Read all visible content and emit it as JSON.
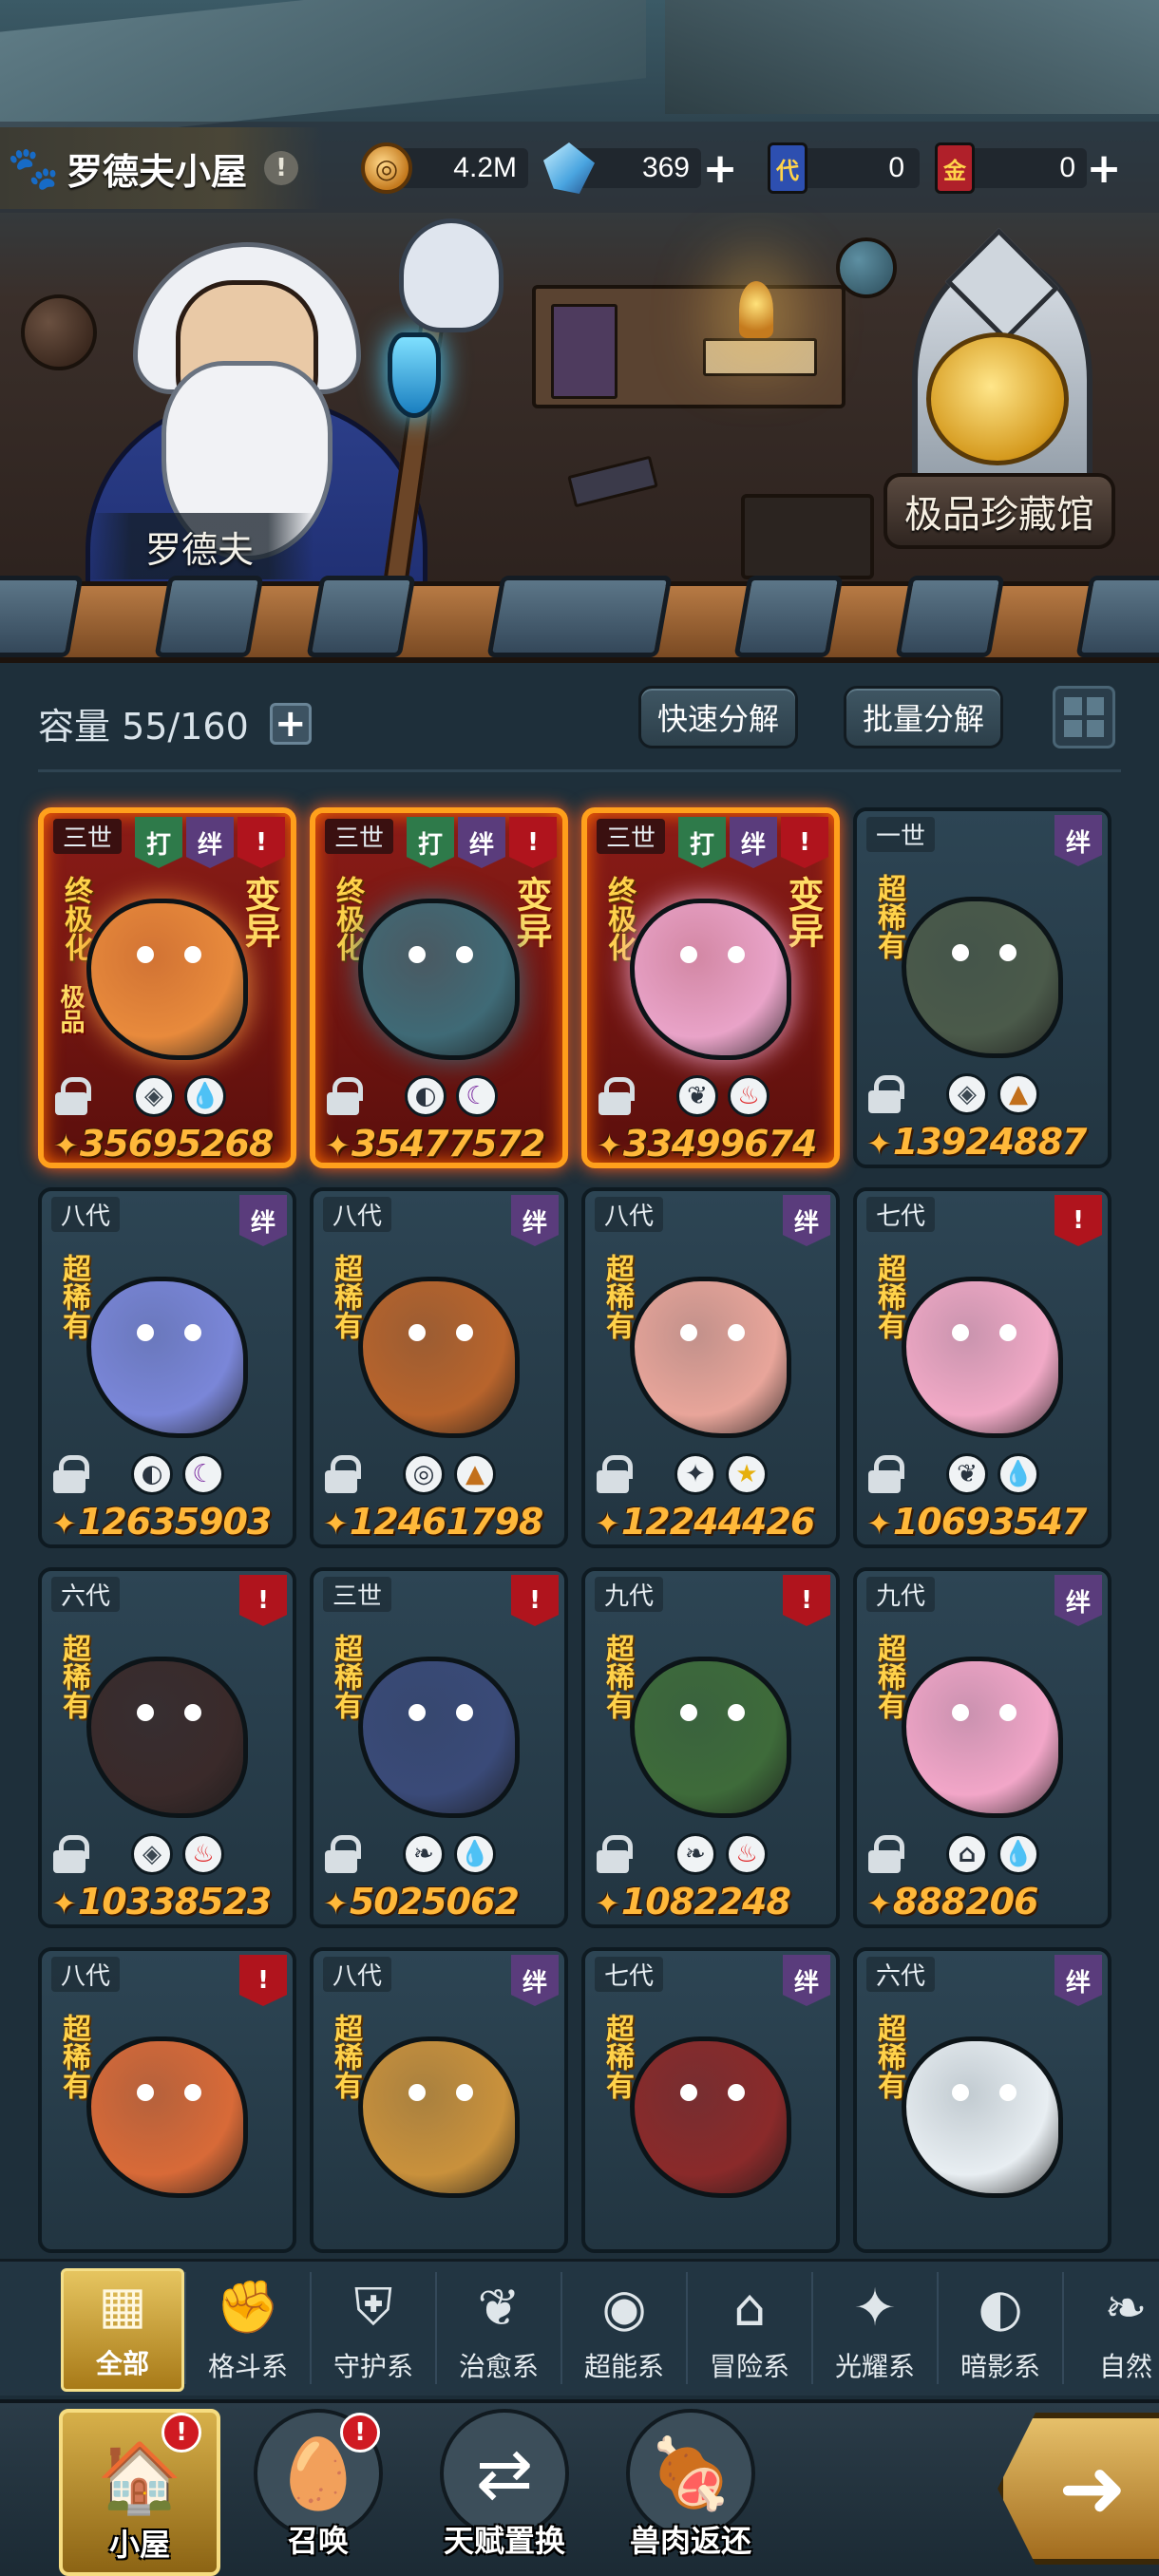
{
  "header": {
    "title": "罗德夫小屋",
    "title_alert": "!",
    "npc_name": "罗德夫",
    "museum_label": "极品珍藏馆"
  },
  "resources": {
    "coins": "4.2M",
    "crystals": "369",
    "blue_card": "0",
    "blue_card_icon_text": "代",
    "red_card": "0",
    "red_card_icon_text": "金"
  },
  "storage": {
    "capacity_label": "容量 55/160",
    "quick_decompose": "快速分解",
    "batch_decompose": "批量分解"
  },
  "pets": [
    {
      "gen": "三世",
      "tags": [
        "打",
        "绊",
        "!"
      ],
      "tier": "终极化",
      "variant": "变异",
      "extra": "极品",
      "attrs": [
        "guard",
        "water"
      ],
      "power": "35695268",
      "rare": true
    },
    {
      "gen": "三世",
      "tags": [
        "打",
        "绊",
        "!"
      ],
      "tier": "终极化",
      "variant": "变异",
      "extra": "",
      "attrs": [
        "shadow",
        "dark"
      ],
      "power": "35477572",
      "rare": true
    },
    {
      "gen": "三世",
      "tags": [
        "打",
        "绊",
        "!"
      ],
      "tier": "终极化",
      "variant": "变异",
      "extra": "",
      "attrs": [
        "heal",
        "fire"
      ],
      "power": "33499674",
      "rare": true
    },
    {
      "gen": "一世",
      "tags": [
        "绊"
      ],
      "tier": "超稀有",
      "variant": "",
      "extra": "",
      "attrs": [
        "guard",
        "earth"
      ],
      "power": "13924887",
      "rare": false
    },
    {
      "gen": "八代",
      "tags": [
        "绊"
      ],
      "tier": "超稀有",
      "variant": "",
      "extra": "",
      "attrs": [
        "shadow",
        "dark"
      ],
      "power": "12635903",
      "rare": false
    },
    {
      "gen": "八代",
      "tags": [
        "绊"
      ],
      "tier": "超稀有",
      "variant": "",
      "extra": "",
      "attrs": [
        "psy",
        "earth"
      ],
      "power": "12461798",
      "rare": false
    },
    {
      "gen": "八代",
      "tags": [
        "绊"
      ],
      "tier": "超稀有",
      "variant": "",
      "extra": "",
      "attrs": [
        "light",
        "star"
      ],
      "power": "12244426",
      "rare": false
    },
    {
      "gen": "七代",
      "tags": [
        "!"
      ],
      "tier": "超稀有",
      "variant": "",
      "extra": "",
      "attrs": [
        "heal",
        "water"
      ],
      "power": "10693547",
      "rare": false
    },
    {
      "gen": "六代",
      "tags": [
        "!"
      ],
      "tier": "超稀有",
      "variant": "",
      "extra": "",
      "attrs": [
        "guard",
        "fire"
      ],
      "power": "10338523",
      "rare": false
    },
    {
      "gen": "三世",
      "tags": [
        "!"
      ],
      "tier": "超稀有",
      "variant": "",
      "extra": "",
      "attrs": [
        "leaf",
        "water"
      ],
      "power": "5025062",
      "rare": false
    },
    {
      "gen": "九代",
      "tags": [
        "!"
      ],
      "tier": "超稀有",
      "variant": "",
      "extra": "",
      "attrs": [
        "leaf",
        "fire"
      ],
      "power": "1082248",
      "rare": false
    },
    {
      "gen": "九代",
      "tags": [
        "绊"
      ],
      "tier": "超稀有",
      "variant": "",
      "extra": "",
      "attrs": [
        "adventure",
        "water"
      ],
      "power": "888206",
      "rare": false
    },
    {
      "gen": "八代",
      "tags": [
        "!"
      ],
      "tier": "超稀有",
      "variant": "",
      "extra": "",
      "attrs": [],
      "power": "",
      "rare": false
    },
    {
      "gen": "八代",
      "tags": [
        "绊"
      ],
      "tier": "超稀有",
      "variant": "",
      "extra": "",
      "attrs": [],
      "power": "",
      "rare": false
    },
    {
      "gen": "七代",
      "tags": [
        "绊"
      ],
      "tier": "超稀有",
      "variant": "",
      "extra": "",
      "attrs": [],
      "power": "",
      "rare": false
    },
    {
      "gen": "六代",
      "tags": [
        "绊"
      ],
      "tier": "超稀有",
      "variant": "",
      "extra": "",
      "attrs": [],
      "power": "",
      "rare": false
    }
  ],
  "pet_colors": [
    "#e88a3c",
    "#3f6a76",
    "#e9a3c8",
    "#4b5a4a",
    "#7a86d8",
    "#b8642c",
    "#e8a59a",
    "#f1a9c6",
    "#3a2a2a",
    "#3a4a78",
    "#3e6b3a",
    "#f2a6c8",
    "#d86a38",
    "#c9913c",
    "#8a2a2a",
    "#e8eef2"
  ],
  "tabs": [
    {
      "label": "全部",
      "icon": "all-icon",
      "active": true
    },
    {
      "label": "格斗系",
      "icon": "fist-icon"
    },
    {
      "label": "守护系",
      "icon": "shield-icon"
    },
    {
      "label": "治愈系",
      "icon": "sprout-icon"
    },
    {
      "label": "超能系",
      "icon": "psychic-icon"
    },
    {
      "label": "冒险系",
      "icon": "lantern-icon"
    },
    {
      "label": "光耀系",
      "icon": "light-icon"
    },
    {
      "label": "暗影系",
      "icon": "shadow-icon"
    },
    {
      "label": "自然",
      "icon": "leaf-icon"
    }
  ],
  "nav": [
    {
      "label": "小屋",
      "icon": "house-icon",
      "active": true,
      "badge": "!"
    },
    {
      "label": "召唤",
      "icon": "egg-icon",
      "badge": "!"
    },
    {
      "label": "天赋置换",
      "icon": "swap-icon"
    },
    {
      "label": "兽肉返还",
      "icon": "meat-icon"
    }
  ],
  "nav_back": "back-arrow-icon"
}
